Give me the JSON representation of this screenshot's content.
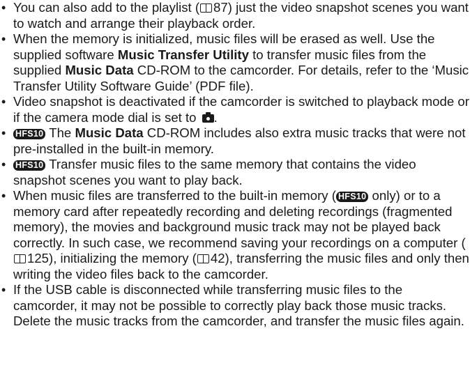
{
  "notes": [
    {
      "a": "You can also add to the playlist (",
      "ref": "87",
      "b": ") just the video snapshot scenes you want to watch and arrange their playback order."
    },
    {
      "a": "When the memory is initialized, music files will be erased as well. Use the supplied software ",
      "b1": "Music Transfer Utility",
      "c": " to transfer music files from the supplied ",
      "b2": "Music Data",
      "d": " CD-ROM to the camcorder. For details, refer to the ‘Music Transfer Utility Software Guide’ (PDF file)."
    },
    {
      "a": "Video snapshot is deactivated if the camcorder is switched to playback mode or if the camera mode dial is set to ",
      "icon": "camera-icon",
      "b": "."
    },
    {
      "model": "HFS10",
      "a": " The ",
      "b1": "Music Data",
      "c": " CD-ROM includes also extra music tracks that were not pre-installed in the built-in memory."
    },
    {
      "model": "HFS10",
      "a": " Transfer music files to the same memory that contains the video snapshot scenes you want to play back."
    },
    {
      "a": "When music files are transferred to the built-in memory (",
      "model": "HFS10",
      "b": " only) or to a memory card after repeatedly recording and deleting recordings (fragmented memory), the movies and background music track may not be played back correctly. In such case, we recommend saving your recordings on a computer (",
      "ref1": "125",
      "c": "), initializing the memory (",
      "ref2": "42",
      "d": "), transferring the music files and only then writing the video files back to the camcorder."
    },
    {
      "a": "If the USB cable is disconnected while transferring music files to the camcorder, it may not be possible to correctly play back those music tracks. Delete the music tracks from the camcorder, and transfer the music files again."
    }
  ],
  "icons": {
    "page_ref": "book-icon",
    "camera": "camera-icon",
    "model_badge": "model-badge"
  },
  "colors": {
    "text": "#1a1a1a",
    "badge_bg": "#1a1a1a",
    "badge_fg": "#ffffff"
  }
}
